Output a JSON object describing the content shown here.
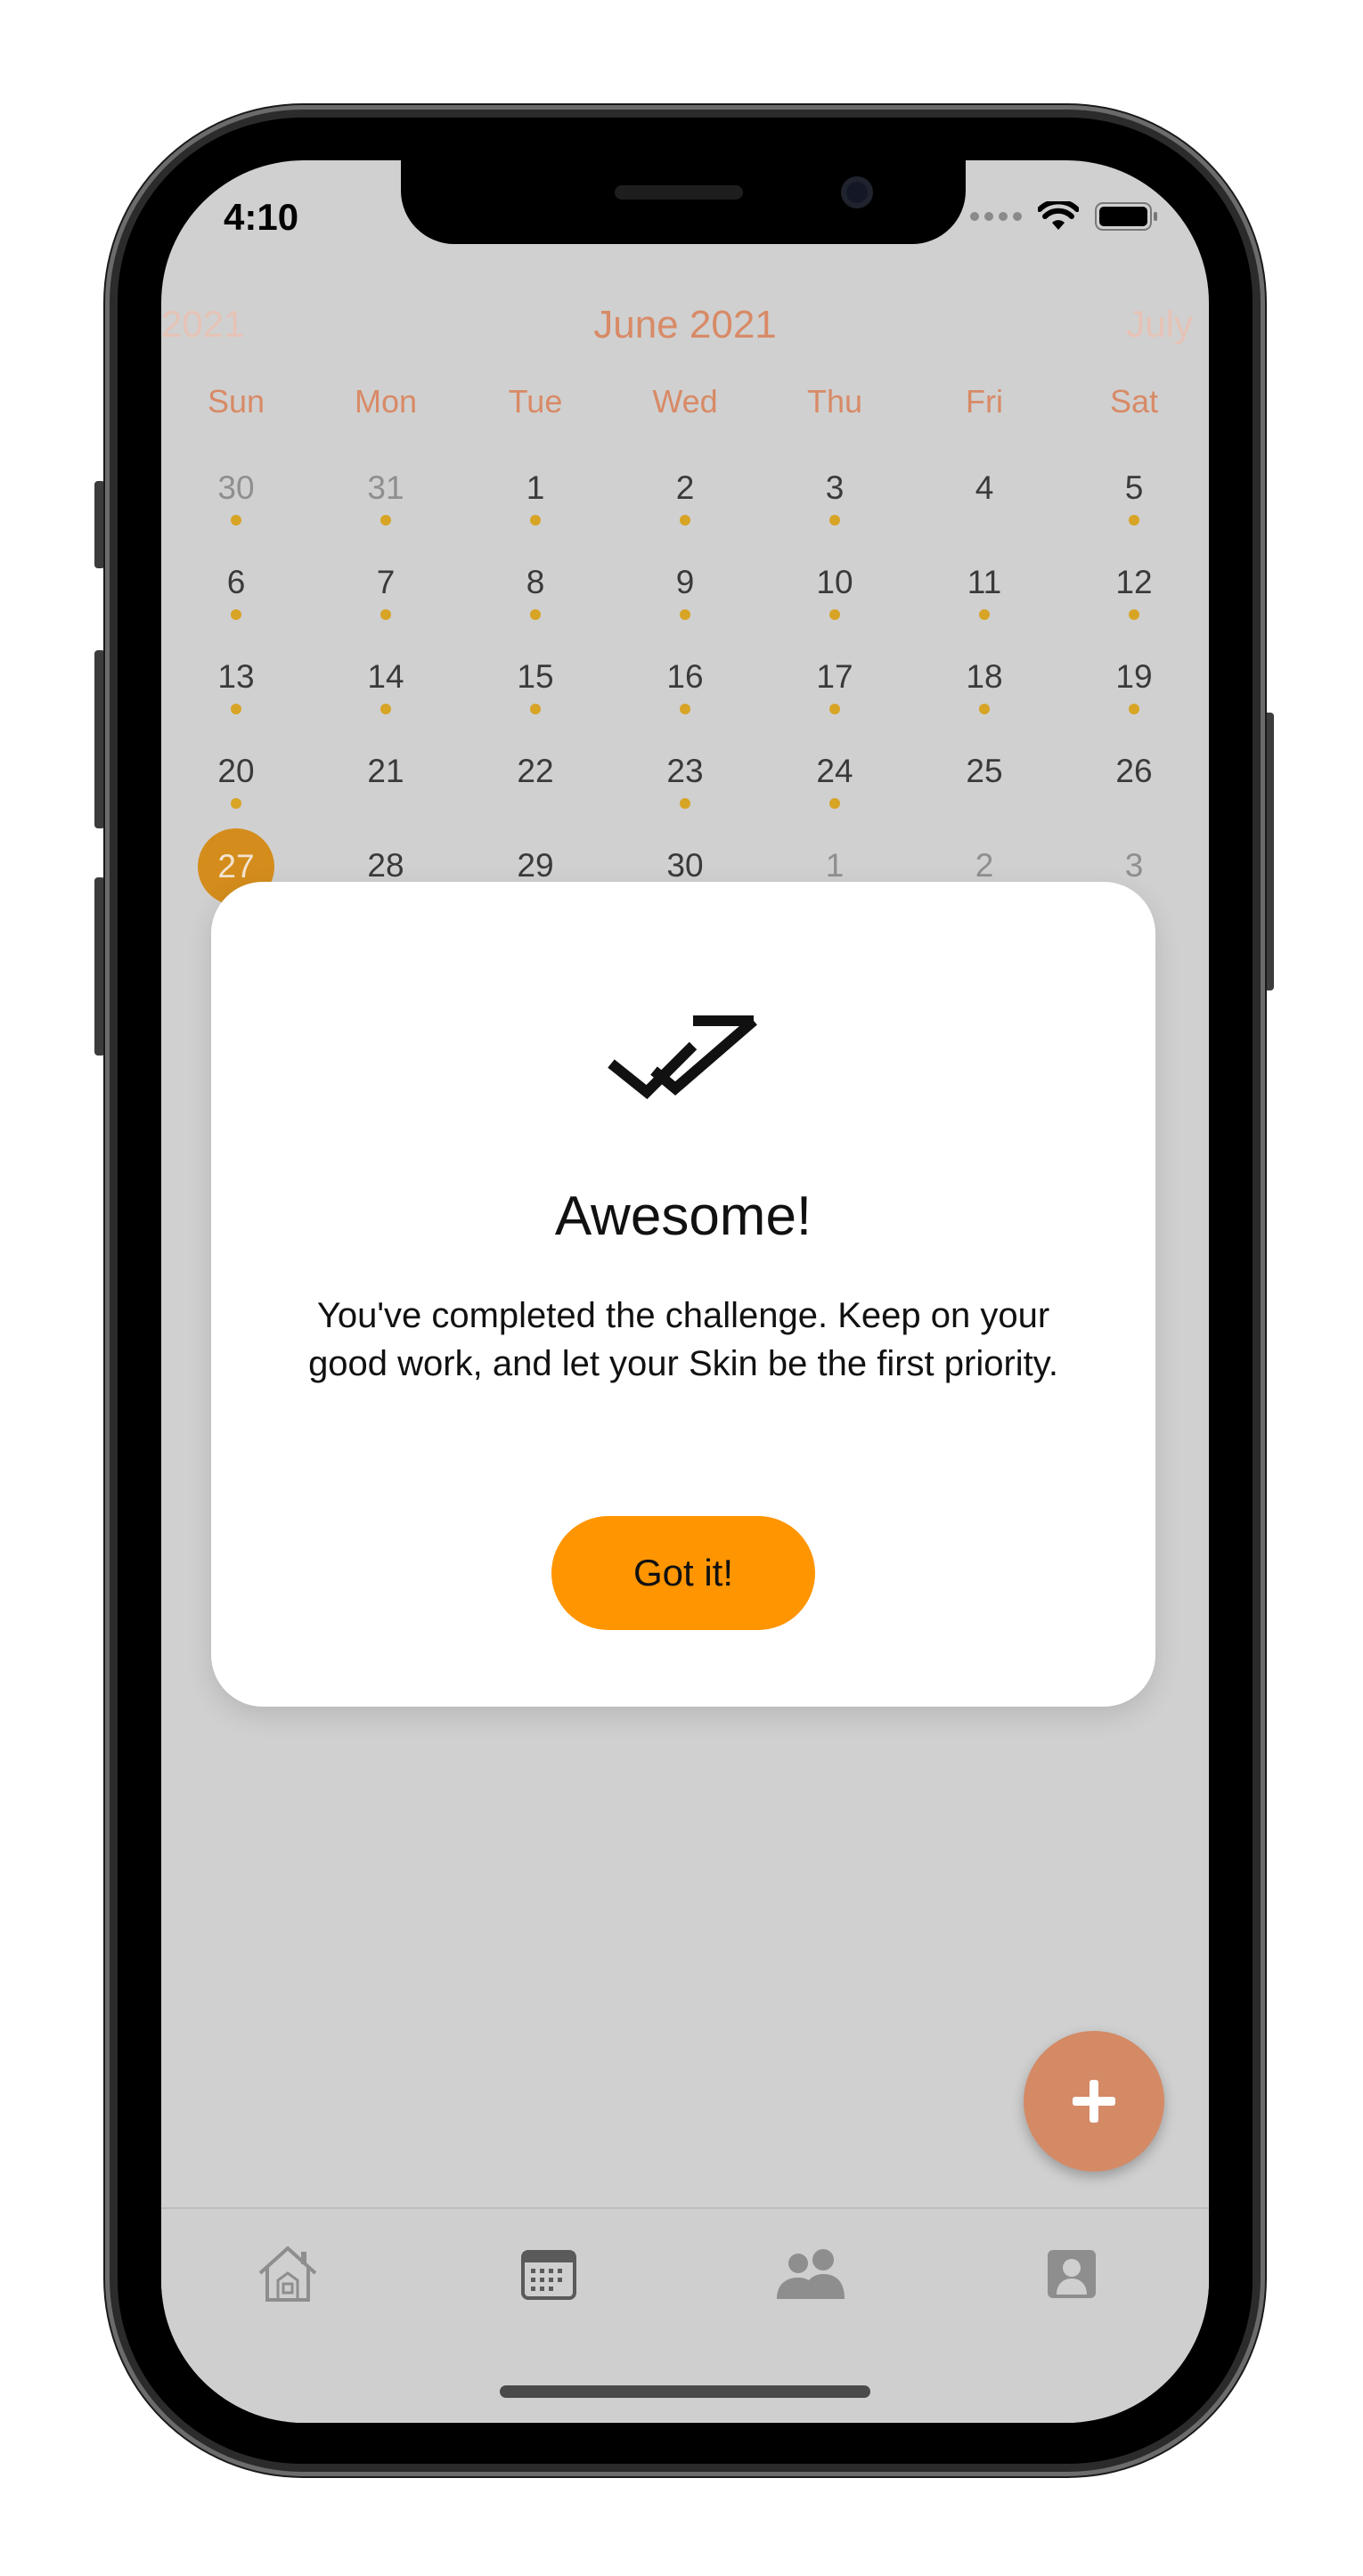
{
  "status_bar": {
    "time": "4:10",
    "icons": [
      "cellular-dots-icon",
      "wifi-icon",
      "battery-icon"
    ]
  },
  "calendar": {
    "prev_month_label": "2021",
    "current_month_label": "June 2021",
    "next_month_label": "July",
    "weekdays": [
      "Sun",
      "Mon",
      "Tue",
      "Wed",
      "Thu",
      "Fri",
      "Sat"
    ],
    "weeks": [
      [
        {
          "d": "30",
          "out": true,
          "dot": true
        },
        {
          "d": "31",
          "out": true,
          "dot": true
        },
        {
          "d": "1",
          "dot": true
        },
        {
          "d": "2",
          "dot": true
        },
        {
          "d": "3",
          "dot": true
        },
        {
          "d": "4",
          "dot": false
        },
        {
          "d": "5",
          "dot": true
        }
      ],
      [
        {
          "d": "6",
          "dot": true
        },
        {
          "d": "7",
          "dot": true
        },
        {
          "d": "8",
          "dot": true
        },
        {
          "d": "9",
          "dot": true
        },
        {
          "d": "10",
          "dot": true
        },
        {
          "d": "11",
          "dot": true
        },
        {
          "d": "12",
          "dot": true
        }
      ],
      [
        {
          "d": "13",
          "dot": true
        },
        {
          "d": "14",
          "dot": true
        },
        {
          "d": "15",
          "dot": true
        },
        {
          "d": "16",
          "dot": true
        },
        {
          "d": "17",
          "dot": true
        },
        {
          "d": "18",
          "dot": true
        },
        {
          "d": "19",
          "dot": true
        }
      ],
      [
        {
          "d": "20",
          "dot": true
        },
        {
          "d": "21",
          "dot": false
        },
        {
          "d": "22",
          "dot": false
        },
        {
          "d": "23",
          "dot": true
        },
        {
          "d": "24",
          "dot": true
        },
        {
          "d": "25",
          "dot": false
        },
        {
          "d": "26",
          "dot": false
        }
      ],
      [
        {
          "d": "27",
          "today": true,
          "dot": false
        },
        {
          "d": "28",
          "dot": false
        },
        {
          "d": "29",
          "dot": false
        },
        {
          "d": "30",
          "dot": false
        },
        {
          "d": "1",
          "out": true,
          "dot": false
        },
        {
          "d": "2",
          "out": true,
          "dot": false
        },
        {
          "d": "3",
          "out": true,
          "dot": false
        }
      ]
    ],
    "accent_color": "#d88a66",
    "dot_color": "#d8a425",
    "today_color": "#d48d1c"
  },
  "modal": {
    "icon": "double-check-icon",
    "title": "Awesome!",
    "body": "You've completed the challenge. Keep on your good work, and let your Skin be the first priority.",
    "button_label": "Got it!",
    "button_color": "#ff9500"
  },
  "fab": {
    "icon": "plus-icon",
    "color": "#d48a65"
  },
  "tabbar": {
    "tabs": [
      {
        "icon": "home-icon"
      },
      {
        "icon": "calendar-icon",
        "selected": true
      },
      {
        "icon": "community-icon"
      },
      {
        "icon": "profile-icon"
      }
    ]
  }
}
